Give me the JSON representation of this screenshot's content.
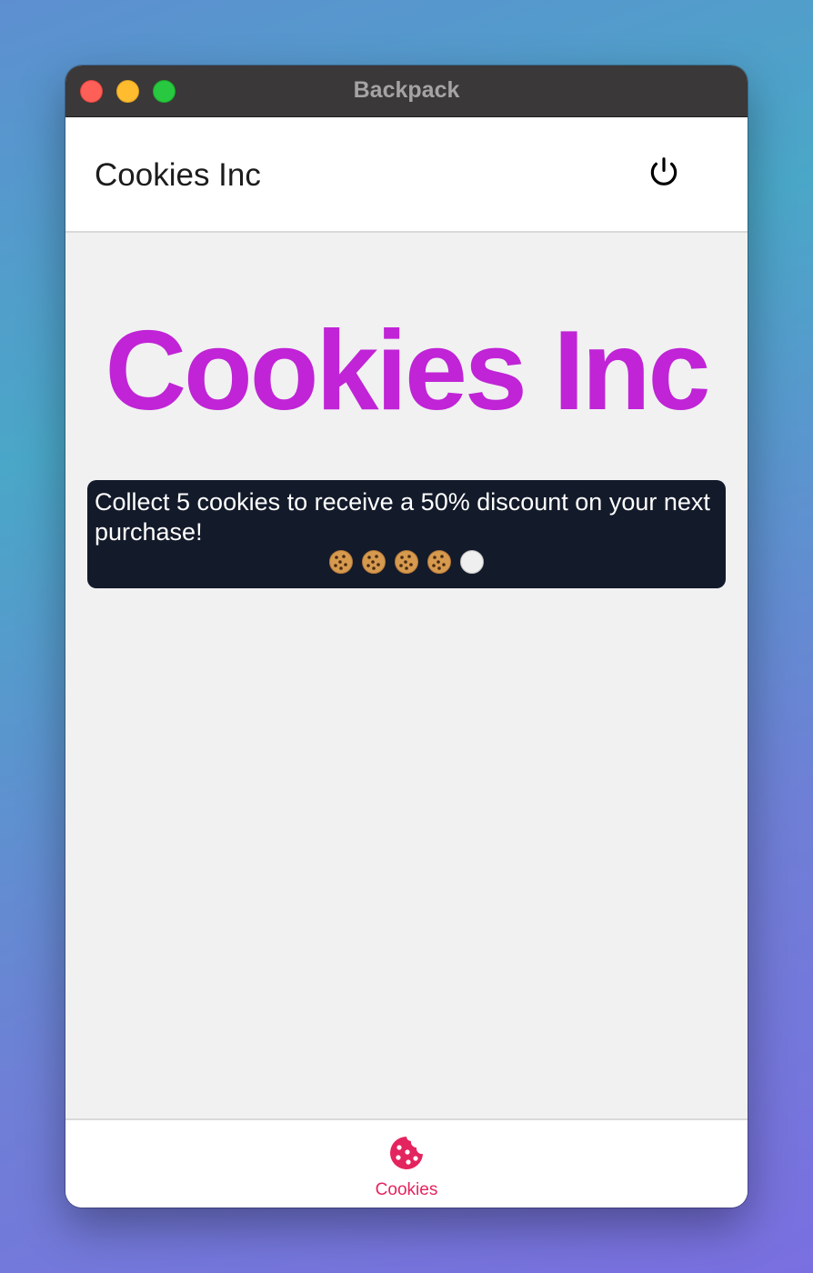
{
  "window": {
    "title": "Backpack"
  },
  "appbar": {
    "title": "Cookies Inc",
    "power_icon": "power-icon"
  },
  "hero": {
    "text": "Cookies Inc",
    "color": "#c024d6"
  },
  "card": {
    "message": "Collect 5 cookies to receive a 50% discount on your next purchase!",
    "stamps_collected": 4,
    "stamps_total": 5
  },
  "tabbar": {
    "tabs": [
      {
        "label": "Cookies",
        "icon": "cookie-icon",
        "active": true,
        "color": "#e4245e"
      }
    ]
  }
}
